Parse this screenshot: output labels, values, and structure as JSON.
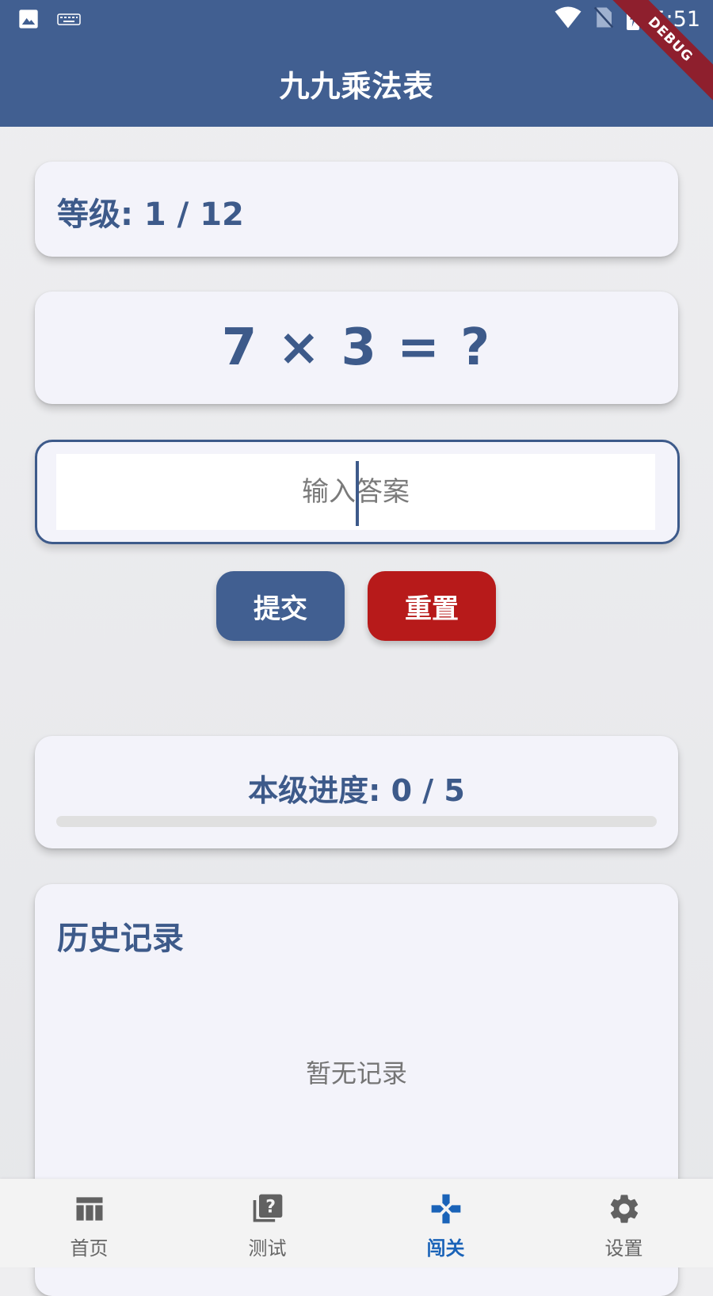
{
  "status_bar": {
    "time": "5:51",
    "left_icons": [
      "image-icon",
      "keyboard-icon"
    ],
    "right_icons": [
      "wifi-icon",
      "no-sim-icon",
      "battery-charging-icon"
    ]
  },
  "debug_banner": "DEBUG",
  "app_bar": {
    "title": "九九乘法表"
  },
  "level": {
    "text": "等级: 1 / 12",
    "current": 1,
    "total": 12
  },
  "question": {
    "text": "7 × 3 = ?"
  },
  "answer_input": {
    "value": "",
    "placeholder": "输入答案"
  },
  "buttons": {
    "submit": "提交",
    "reset": "重置"
  },
  "progress": {
    "text": "本级进度: 0 / 5",
    "current": 0,
    "total": 5,
    "fraction": 0
  },
  "history": {
    "title": "历史记录",
    "empty_text": "暂无记录"
  },
  "bottom_nav": {
    "items": [
      {
        "label": "首页",
        "icon": "table-icon",
        "active": false
      },
      {
        "label": "测试",
        "icon": "quiz-icon",
        "active": false
      },
      {
        "label": "闯关",
        "icon": "gamepad-icon",
        "active": true
      },
      {
        "label": "设置",
        "icon": "gear-icon",
        "active": false
      }
    ]
  },
  "colors": {
    "primary": "#415f91",
    "danger": "#b71a1a",
    "active_nav": "#1a63b8",
    "card_background": "#f3f3fa"
  }
}
